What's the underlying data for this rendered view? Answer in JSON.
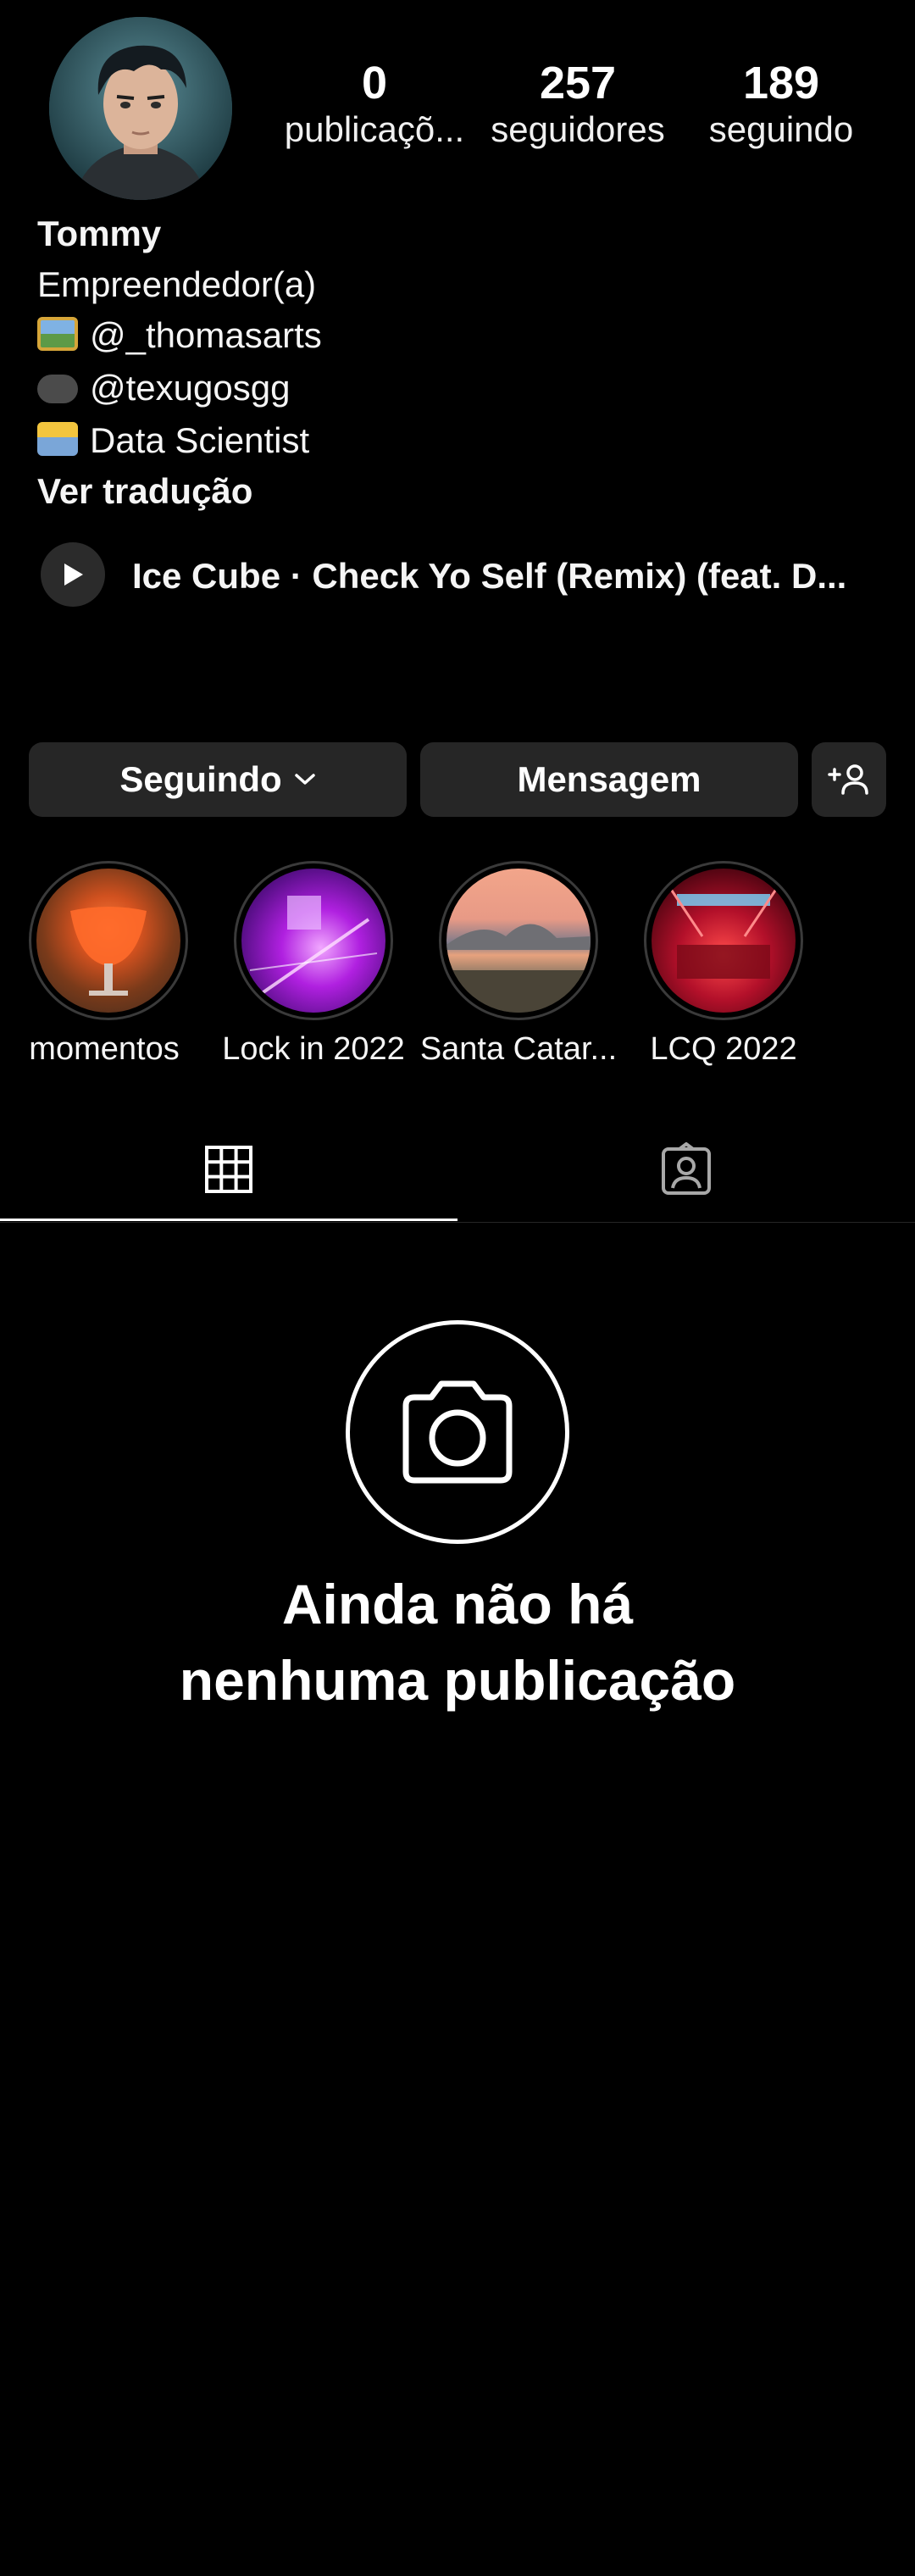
{
  "profile": {
    "name": "Tommy",
    "stats": [
      {
        "value": "0",
        "label": "publicaçõ..."
      },
      {
        "value": "257",
        "label": "seguidores"
      },
      {
        "value": "189",
        "label": "seguindo"
      }
    ],
    "bio_lines": [
      {
        "icon": "framed-picture-emoji-icon",
        "text": "Empreendedor(a)"
      },
      {
        "icon": "framed-picture-emoji-icon",
        "text": "@_thomasarts"
      },
      {
        "icon": "video-game-emoji-icon",
        "text": "@texugosgg"
      },
      {
        "icon": "technologist-emoji-icon",
        "text": "Data Scientist"
      }
    ],
    "see_translation": "Ver tradução"
  },
  "music": {
    "title": "Ice Cube · Check Yo Self (Remix) (feat. D..."
  },
  "actions": {
    "following_label": "Seguindo",
    "message_label": "Mensagem",
    "add_person_icon": "add-person-icon"
  },
  "highlights": [
    {
      "label": "momentos"
    },
    {
      "label": "Lock in 2022"
    },
    {
      "label": "Santa Catar..."
    },
    {
      "label": "LCQ 2022"
    }
  ],
  "tabs": [
    {
      "icon": "grid-icon",
      "active": true
    },
    {
      "icon": "tagged-icon",
      "active": false
    }
  ],
  "empty_state": {
    "line1": "Ainda não há",
    "line2": "nenhuma publicação"
  },
  "colors": {
    "background": "#000000",
    "button": "#262626",
    "text": "#ffffff"
  }
}
